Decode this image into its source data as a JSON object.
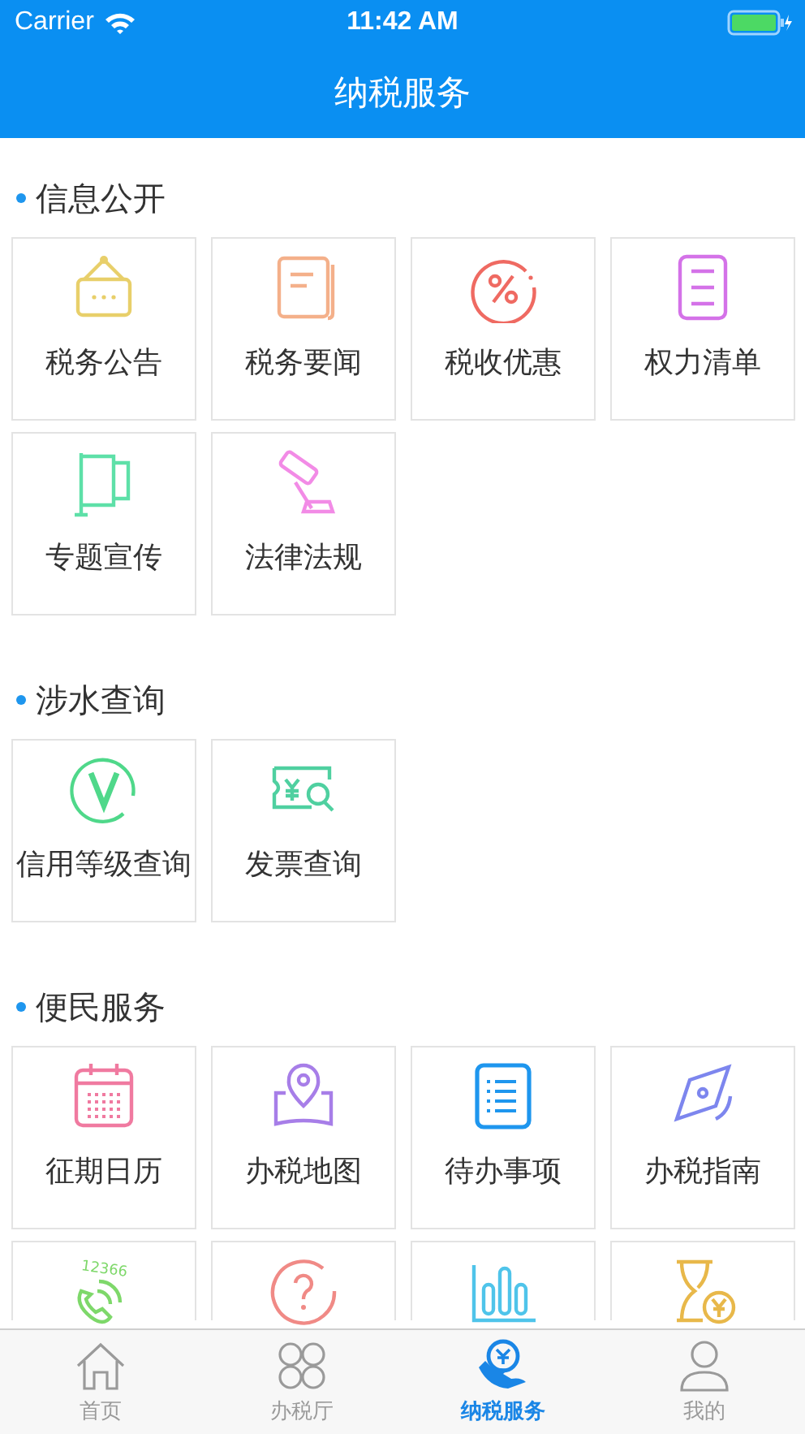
{
  "status_bar": {
    "carrier": "Carrier",
    "time": "11:42 AM"
  },
  "nav": {
    "title": "纳税服务"
  },
  "sections": [
    {
      "title": "信息公开",
      "items": [
        {
          "label": "税务公告"
        },
        {
          "label": "税务要闻"
        },
        {
          "label": "税收优惠"
        },
        {
          "label": "权力清单"
        },
        {
          "label": "专题宣传"
        },
        {
          "label": "法律法规"
        }
      ]
    },
    {
      "title": "涉水查询",
      "items": [
        {
          "label": "信用等级查询"
        },
        {
          "label": "发票查询"
        }
      ]
    },
    {
      "title": "便民服务",
      "items": [
        {
          "kind": "full",
          "label": "征期日历"
        },
        {
          "kind": "full",
          "label": "办税地图"
        },
        {
          "kind": "full",
          "label": "待办事项"
        },
        {
          "kind": "full",
          "label": "办税指南"
        },
        {
          "kind": "cut",
          "icon_text": "12366"
        },
        {
          "kind": "cut"
        },
        {
          "kind": "cut"
        },
        {
          "kind": "cut"
        }
      ]
    }
  ],
  "tab_bar": [
    {
      "label": "首页",
      "selected": false
    },
    {
      "label": "办税厅",
      "selected": false
    },
    {
      "label": "纳税服务",
      "selected": true
    },
    {
      "label": "我的",
      "selected": false
    }
  ]
}
